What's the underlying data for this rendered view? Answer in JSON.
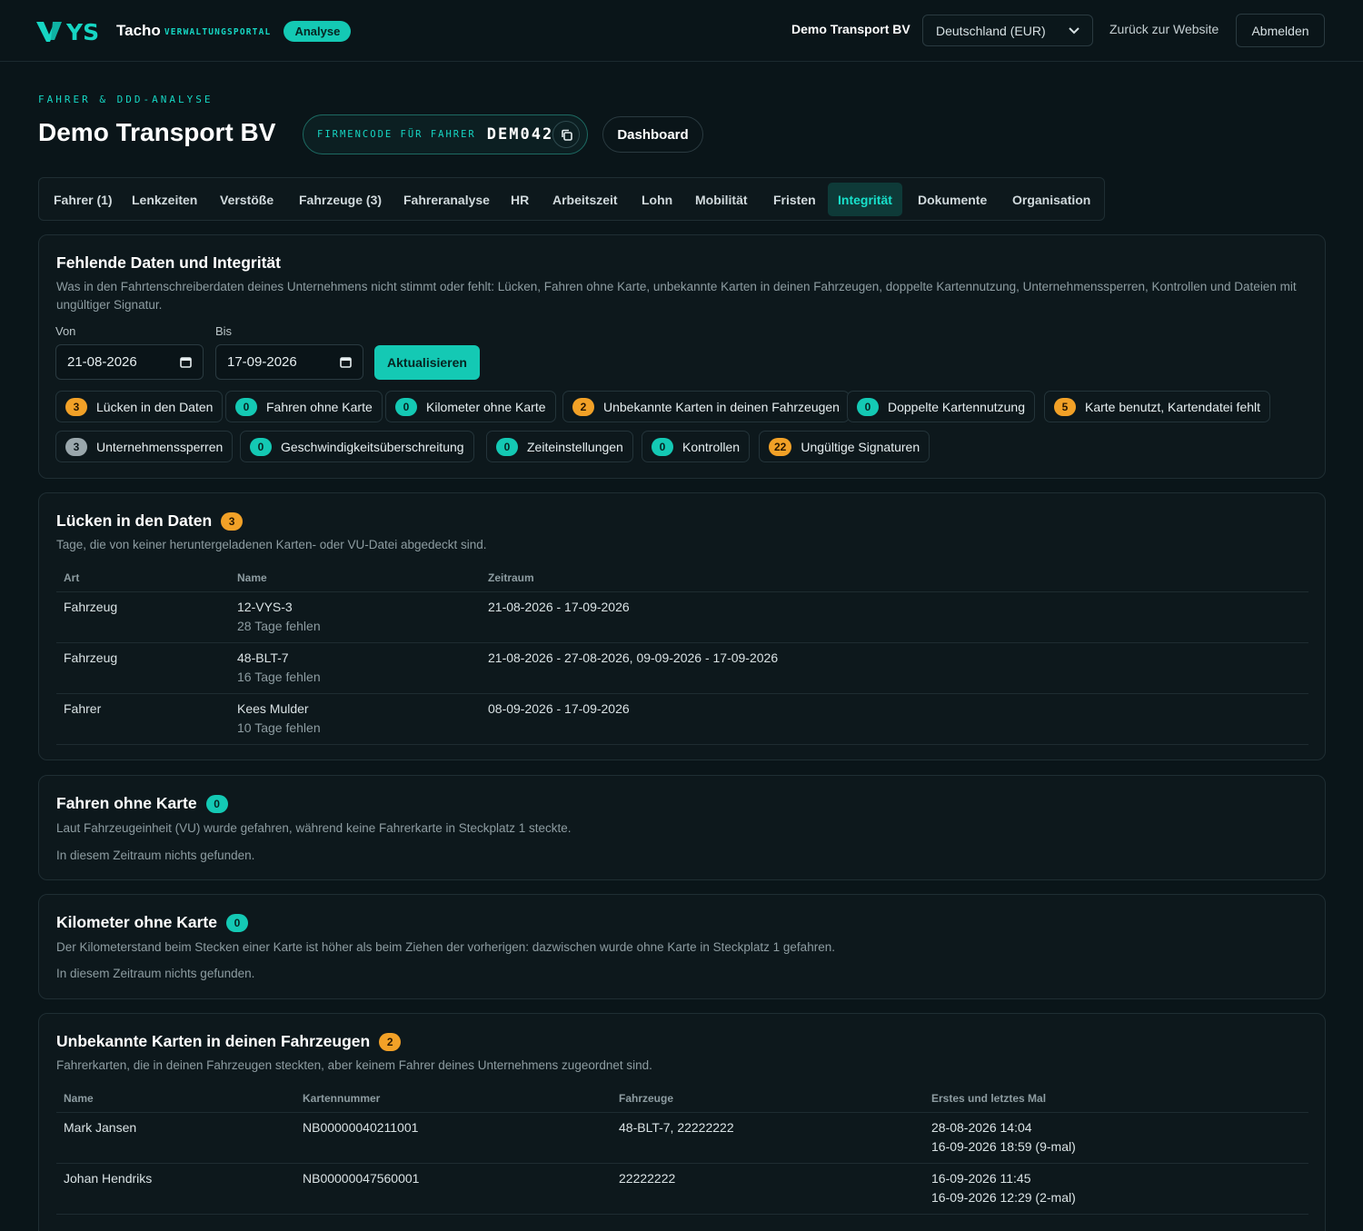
{
  "header": {
    "brand_letters": "YS",
    "brand": "Tacho",
    "brand_sub": "VERWALTUNGSPORTAL",
    "mode_pill": "Analyse",
    "company": "Demo Transport BV",
    "country_select": "Deutschland (EUR)",
    "back_link": "Zurück zur Website",
    "logout": "Abmelden"
  },
  "page": {
    "eyebrow": "FAHRER & DDD-ANALYSE",
    "title": "Demo Transport BV",
    "code_label": "FIRMENCODE FÜR FAHRER",
    "code_value": "DEM042",
    "dashboard_button": "Dashboard"
  },
  "tabs": [
    {
      "label": "Fahrer (1)"
    },
    {
      "label": "Lenkzeiten"
    },
    {
      "label": "Verstöße"
    },
    {
      "label": "Fahrzeuge (3)"
    },
    {
      "label": "Fahreranalyse"
    },
    {
      "label": "HR"
    },
    {
      "label": "Arbeitszeit"
    },
    {
      "label": "Lohn"
    },
    {
      "label": "Mobilität"
    },
    {
      "label": "Fristen"
    },
    {
      "label": "Integrität",
      "active": true
    },
    {
      "label": "Dokumente"
    },
    {
      "label": "Organisation"
    }
  ],
  "overview": {
    "title": "Fehlende Daten und Integrität",
    "description": "Was in den Fahrtenschreiberdaten deines Unternehmens nicht stimmt oder fehlt: Lücken, Fahren ohne Karte, unbekannte Karten in deinen Fahrzeugen, doppelte Kartennutzung, Unternehmenssperren, Kontrollen und Dateien mit ungültiger Signatur.",
    "from_label": "Von",
    "from_value": "21-08-2026",
    "to_label": "Bis",
    "to_value": "17-09-2026",
    "refresh_button": "Aktualisieren",
    "chips": [
      {
        "count": "3",
        "label": "Lücken in den Daten",
        "color": "orange"
      },
      {
        "count": "0",
        "label": "Fahren ohne Karte",
        "color": "teal"
      },
      {
        "count": "0",
        "label": "Kilometer ohne Karte",
        "color": "teal"
      },
      {
        "count": "2",
        "label": "Unbekannte Karten in deinen Fahrzeugen",
        "color": "orange"
      },
      {
        "count": "0",
        "label": "Doppelte Kartennutzung",
        "color": "teal"
      },
      {
        "count": "5",
        "label": "Karte benutzt, Kartendatei fehlt",
        "color": "orange"
      },
      {
        "count": "3",
        "label": "Unternehmenssperren",
        "color": "grey"
      },
      {
        "count": "0",
        "label": "Geschwindigkeitsüberschreitung",
        "color": "teal"
      },
      {
        "count": "0",
        "label": "Zeiteinstellungen",
        "color": "teal"
      },
      {
        "count": "0",
        "label": "Kontrollen",
        "color": "teal"
      },
      {
        "count": "22",
        "label": "Ungültige Signaturen",
        "color": "orange"
      }
    ]
  },
  "gaps": {
    "title": "Lücken in den Daten",
    "count": "3",
    "description": "Tage, die von keiner heruntergeladenen Karten- oder VU-Datei abgedeckt sind.",
    "columns": [
      "Art",
      "Name",
      "Zeitraum"
    ],
    "rows": [
      {
        "type": "Fahrzeug",
        "name": "12-VYS-3",
        "sub": "28 Tage fehlen",
        "period": "21-08-2026 - 17-09-2026"
      },
      {
        "type": "Fahrzeug",
        "name": "48-BLT-7",
        "sub": "16 Tage fehlen",
        "period": "21-08-2026 - 27-08-2026, 09-09-2026 - 17-09-2026"
      },
      {
        "type": "Fahrer",
        "name": "Kees Mulder",
        "sub": "10 Tage fehlen",
        "period": "08-09-2026 - 17-09-2026"
      }
    ]
  },
  "no_card": {
    "title": "Fahren ohne Karte",
    "count": "0",
    "description": "Laut Fahrzeugeinheit (VU) wurde gefahren, während keine Fahrerkarte in Steckplatz 1 steckte.",
    "empty": "In diesem Zeitraum nichts gefunden."
  },
  "km_no_card": {
    "title": "Kilometer ohne Karte",
    "count": "0",
    "description": "Der Kilometerstand beim Stecken einer Karte ist höher als beim Ziehen der vorherigen: dazwischen wurde ohne Karte in Steckplatz 1 gefahren.",
    "empty": "In diesem Zeitraum nichts gefunden."
  },
  "unknown_cards": {
    "title": "Unbekannte Karten in deinen Fahrzeugen",
    "count": "2",
    "description": "Fahrerkarten, die in deinen Fahrzeugen steckten, aber keinem Fahrer deines Unternehmens zugeordnet sind.",
    "columns": [
      "Name",
      "Kartennummer",
      "Fahrzeuge",
      "Erstes und letztes Mal"
    ],
    "rows": [
      {
        "name": "Mark Jansen",
        "card": "NB00000040211001",
        "vehicles": "48-BLT-7, 22222222",
        "first": "28-08-2026 14:04",
        "last": "16-09-2026 18:59 (9-mal)"
      },
      {
        "name": "Johan Hendriks",
        "card": "NB00000047560001",
        "vehicles": "22222222",
        "first": "16-09-2026 11:45",
        "last": "16-09-2026 12:29 (2-mal)"
      }
    ]
  }
}
